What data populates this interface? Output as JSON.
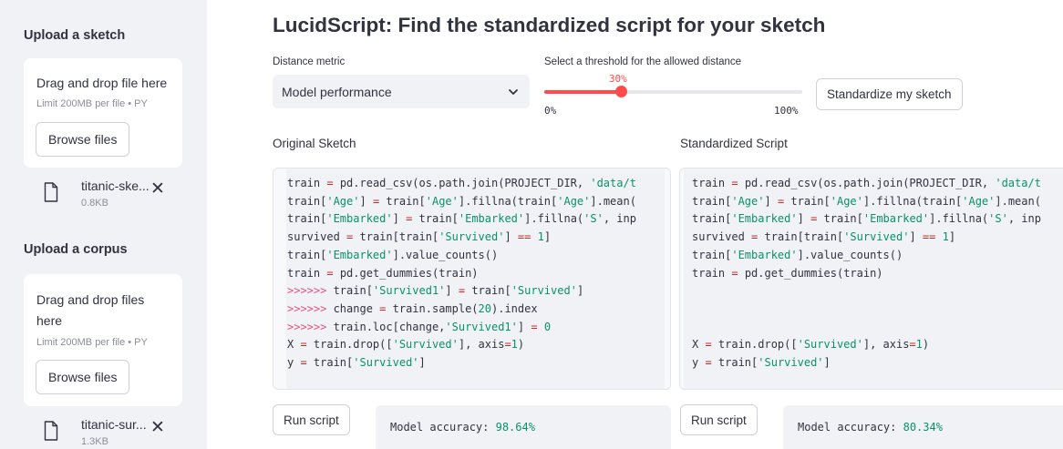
{
  "sidebar": {
    "sketch": {
      "heading": "Upload a sketch",
      "dropzone_title": "Drag and drop file here",
      "dropzone_limit": "Limit 200MB per file • PY",
      "browse_label": "Browse files",
      "file_name": "titanic-ske...",
      "file_size": "0.8KB",
      "close_glyph": "✕"
    },
    "corpus": {
      "heading": "Upload a corpus",
      "dropzone_title_1": "Drag and drop files",
      "dropzone_title_2": "here",
      "dropzone_limit": "Limit 200MB per file • PY",
      "browse_label": "Browse files",
      "file_name": "titanic-sur...",
      "file_size": "1.3KB",
      "close_glyph": "✕"
    }
  },
  "main": {
    "title": "LucidScript: Find the standardized script for your sketch",
    "metric": {
      "label": "Distance metric",
      "value": "Model performance"
    },
    "threshold": {
      "label": "Select a threshold for the allowed distance",
      "value_label": "30%",
      "value_fraction": 0.3,
      "min_label": "0%",
      "max_label": "100%"
    },
    "standardize_label": "Standardize my sketch",
    "original": {
      "label": "Original Sketch",
      "run_label": "Run script",
      "result_label": "Model accuracy: ",
      "result_value": "98.64%",
      "code_lines": [
        "train = pd.read_csv(os.path.join(PROJECT_DIR, 'data/t",
        "train['Age'] = train['Age'].fillna(train['Age'].mean(",
        "train['Embarked'] = train['Embarked'].fillna('S', inp",
        "survived = train[train['Survived'] == 1]",
        "train['Embarked'].value_counts()",
        "train = pd.get_dummies(train)",
        ">>>>>> train['Survived1'] = train['Survived']",
        ">>>>>> change = train.sample(20).index",
        ">>>>>> train.loc[change,'Survived1'] = 0",
        "X = train.drop(['Survived'], axis=1)",
        "y = train['Survived']"
      ]
    },
    "standardized": {
      "label": "Standardized Script",
      "run_label": "Run script",
      "result_label": "Model accuracy: ",
      "result_value": "80.34%",
      "code_lines": [
        "train = pd.read_csv(os.path.join(PROJECT_DIR, 'data/t",
        "train['Age'] = train['Age'].fillna(train['Age'].mean(",
        "train['Embarked'] = train['Embarked'].fillna('S', inp",
        "survived = train[train['Survived'] == 1]",
        "train['Embarked'].value_counts()",
        "train = pd.get_dummies(train)",
        "",
        "",
        "",
        "X = train.drop(['Survived'], axis=1)",
        "y = train['Survived']"
      ]
    }
  },
  "colors": {
    "accent": "#ff4b4b",
    "code_string": "#099268",
    "sidebar_bg": "#f0f2f6"
  }
}
